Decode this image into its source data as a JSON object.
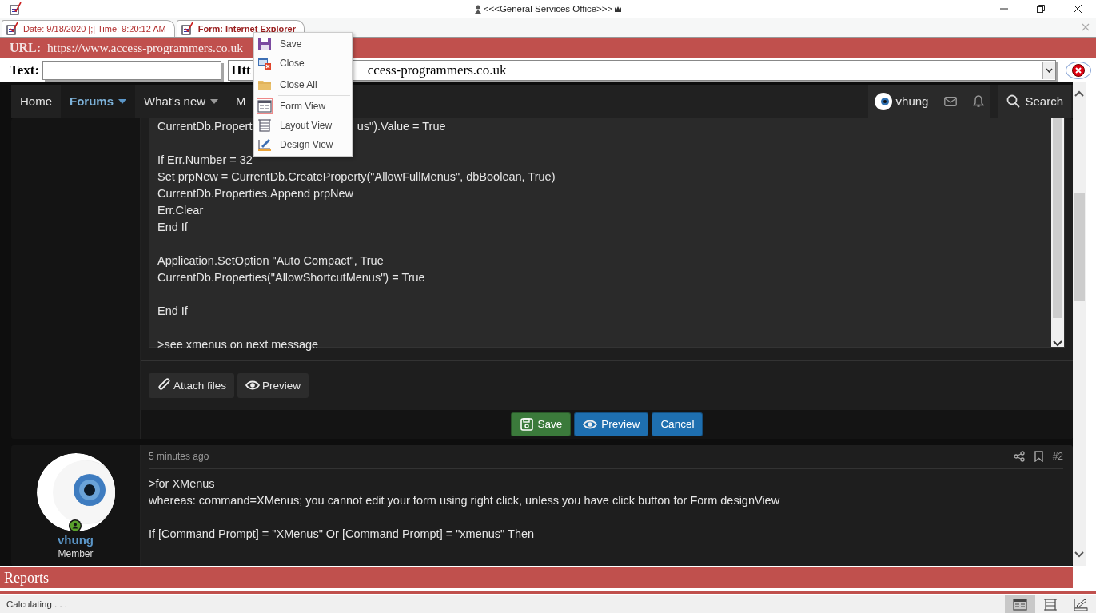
{
  "window": {
    "title": "<<<General Services Office>>>"
  },
  "tabs": [
    {
      "label": "Date: 9/18/2020 |;| Time: 9:20:12 AM",
      "selected": false
    },
    {
      "label": "Form: Internet Explorer",
      "selected": true
    }
  ],
  "url_bar": {
    "label": "URL:",
    "value": "https://www.access-programmers.co.uk"
  },
  "text_row": {
    "label": "Text:",
    "combo_label": "Htt",
    "combo_value": "ccess-programmers.co.uk"
  },
  "context_menu": {
    "items": [
      {
        "label": "Save",
        "kind": "save",
        "separator_before": false,
        "selected": false
      },
      {
        "label": "Close",
        "kind": "close",
        "separator_before": false,
        "selected": false
      },
      {
        "label": "Close All",
        "kind": "close_all",
        "separator_before": true,
        "selected": false
      },
      {
        "label": "Form View",
        "kind": "form_view",
        "separator_before": true,
        "selected": true
      },
      {
        "label": "Layout View",
        "kind": "layout_view",
        "separator_before": false,
        "selected": false
      },
      {
        "label": "Design View",
        "kind": "design_view",
        "separator_before": false,
        "selected": false
      }
    ]
  },
  "forum": {
    "nav": [
      {
        "label": "Home",
        "selected": false,
        "dropdown": false
      },
      {
        "label": "Forums",
        "selected": true,
        "dropdown": true
      },
      {
        "label": "What's new",
        "selected": false,
        "dropdown": true
      },
      {
        "label": "M",
        "selected": false,
        "dropdown": false
      }
    ],
    "user": "vhung",
    "search": "Search",
    "editor": {
      "blocks": [
        [
          [
            "CurrentDb.Properti",
            "us\").Value = True"
          ]
        ],
        [
          [
            "If Err.Number = 32"
          ],
          [
            "Set prpNew = CurrentDb.CreateProperty(\"AllowFullMenus\", dbBoolean, True)"
          ],
          [
            "CurrentDb.Properties.Append prpNew"
          ],
          [
            "Err.Clear"
          ],
          [
            "End If"
          ]
        ],
        [
          [
            "Application.SetOption \"Auto Compact\", True"
          ],
          [
            "CurrentDb.Properties(\"AllowShortcutMenus\") = True"
          ]
        ],
        [
          [
            "End If"
          ]
        ],
        [
          [
            ">see xmenus on next message"
          ]
        ]
      ],
      "tools": [
        {
          "label": "Attach files",
          "kind": "attach"
        },
        {
          "label": "Preview",
          "kind": "preview"
        }
      ],
      "actions": [
        {
          "label": "Save",
          "kind": "save"
        },
        {
          "label": "Preview",
          "kind": "preview"
        },
        {
          "label": "Cancel",
          "kind": "cancel"
        }
      ]
    },
    "post": {
      "author": "vhung",
      "role": "Member",
      "online": true,
      "time": "5 minutes ago",
      "number": "#2",
      "blocks": [
        [
          ">for XMenus",
          "whereas: command=XMenus; you cannot edit your form using right click, unless you have click button for Form designView"
        ],
        [
          "If [Command Prompt] = \"XMenus\" Or [Command Prompt] = \"xmenus\" Then"
        ]
      ]
    }
  },
  "reports_bar": {
    "label": "Reports"
  },
  "status_bar": {
    "text": "Calculating . . .",
    "views": [
      {
        "kind": "form",
        "selected": true
      },
      {
        "kind": "layout",
        "selected": false
      },
      {
        "kind": "design",
        "selected": false
      }
    ]
  }
}
